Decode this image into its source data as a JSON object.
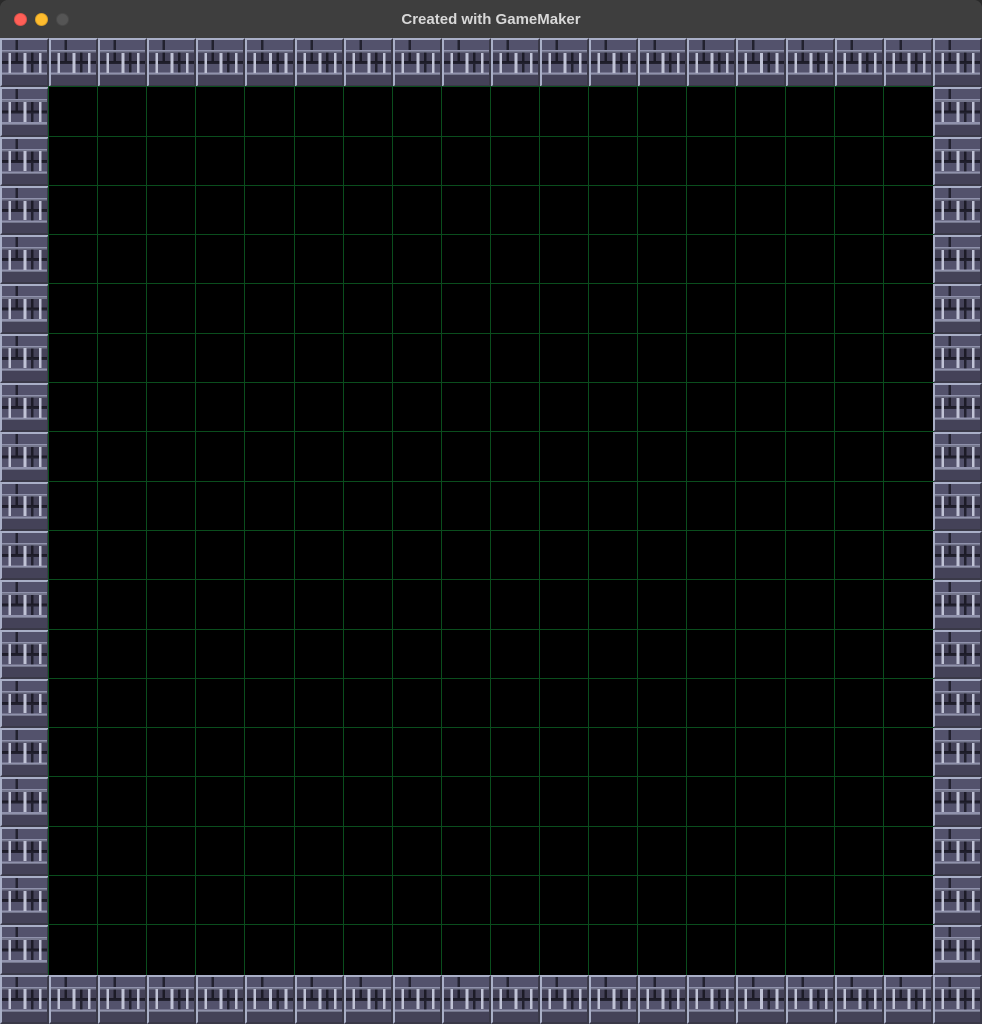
{
  "window": {
    "title": "Created with GameMaker",
    "platform": "macOS",
    "controls": {
      "close": "close",
      "minimize": "minimize",
      "maximize_disabled": "maximize (disabled)"
    }
  },
  "game": {
    "grid": {
      "cols": 20,
      "rows": 20,
      "cell_type_wall": "wall",
      "cell_type_floor": "floor",
      "grid_line_color": "#0a4d1d",
      "floor_color": "#000000",
      "wall_palette": {
        "brick_dark": "#4a4960",
        "brick_light": "#8b8aa3",
        "mortar_light": "#c0c3d6",
        "mortar_dark": "#2d2c3a",
        "bevel_light": "#a9afc7",
        "bevel_dark": "#3a3948"
      }
    },
    "layout_description": "Outer 1-tile-thick wall border surrounding an 18×18 empty black playfield with green grid lines."
  }
}
